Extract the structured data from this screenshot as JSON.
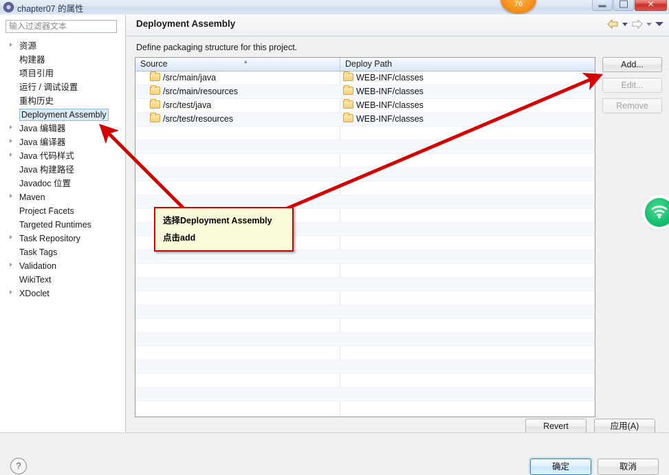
{
  "window": {
    "title": "chapter07 的属性",
    "icon": "eclipse-properties-icon",
    "minimize_label": "",
    "maximize_label": "",
    "close_label": "✕",
    "badge_text": "76"
  },
  "sidebar": {
    "filter": {
      "placeholder": "输入过滤器文本",
      "value": ""
    },
    "items": [
      {
        "label": "资源",
        "expandable": true,
        "selected": false
      },
      {
        "label": "构建器",
        "expandable": false,
        "selected": false
      },
      {
        "label": "项目引用",
        "expandable": false,
        "selected": false
      },
      {
        "label": "运行 / 调试设置",
        "expandable": false,
        "selected": false
      },
      {
        "label": "重构历史",
        "expandable": false,
        "selected": false
      },
      {
        "label": "Deployment Assembly",
        "expandable": false,
        "selected": true
      },
      {
        "label": "Java 编辑器",
        "expandable": true,
        "selected": false
      },
      {
        "label": "Java 编译器",
        "expandable": true,
        "selected": false
      },
      {
        "label": "Java 代码样式",
        "expandable": true,
        "selected": false
      },
      {
        "label": "Java 构建路径",
        "expandable": false,
        "selected": false
      },
      {
        "label": "Javadoc 位置",
        "expandable": false,
        "selected": false
      },
      {
        "label": "Maven",
        "expandable": true,
        "selected": false
      },
      {
        "label": "Project Facets",
        "expandable": false,
        "selected": false
      },
      {
        "label": "Targeted Runtimes",
        "expandable": false,
        "selected": false
      },
      {
        "label": "Task Repository",
        "expandable": true,
        "selected": false
      },
      {
        "label": "Task Tags",
        "expandable": false,
        "selected": false
      },
      {
        "label": "Validation",
        "expandable": true,
        "selected": false
      },
      {
        "label": "WikiText",
        "expandable": false,
        "selected": false
      },
      {
        "label": "XDoclet",
        "expandable": true,
        "selected": false
      }
    ]
  },
  "page": {
    "title": "Deployment Assembly",
    "description": "Define packaging structure for this project.",
    "nav": {
      "back_icon": "back-arrow-icon",
      "back_menu_icon": "chevron-down-icon",
      "forward_icon": "forward-arrow-icon",
      "forward_menu_icon": "chevron-down-icon",
      "more_icon": "chevron-down-icon"
    }
  },
  "table": {
    "columns": [
      "Source",
      "Deploy Path"
    ],
    "sort_indicator": "▴",
    "rows": [
      {
        "source": "/src/main/java",
        "deploy": "WEB-INF/classes"
      },
      {
        "source": "/src/main/resources",
        "deploy": "WEB-INF/classes"
      },
      {
        "source": "/src/test/java",
        "deploy": "WEB-INF/classes"
      },
      {
        "source": "/src/test/resources",
        "deploy": "WEB-INF/classes"
      }
    ],
    "empty_row_count": 21,
    "folder_icon": "folder-icon"
  },
  "side_buttons": [
    {
      "label": "Add...",
      "enabled": true
    },
    {
      "label": "Edit...",
      "enabled": false
    },
    {
      "label": "Remove",
      "enabled": false
    }
  ],
  "apply_bar": {
    "revert_label": "Revert",
    "apply_label": "应用(A)"
  },
  "footer": {
    "help_icon": "question-mark-icon",
    "ok_label": "确定",
    "cancel_label": "取消"
  },
  "annotations": {
    "callout_line1": "选择Deployment Assembly",
    "callout_line2": "点击add",
    "arrow_color": "#d40000"
  },
  "floating_widget": {
    "icon": "wifi-signal-icon",
    "color": "#14bd6c"
  }
}
